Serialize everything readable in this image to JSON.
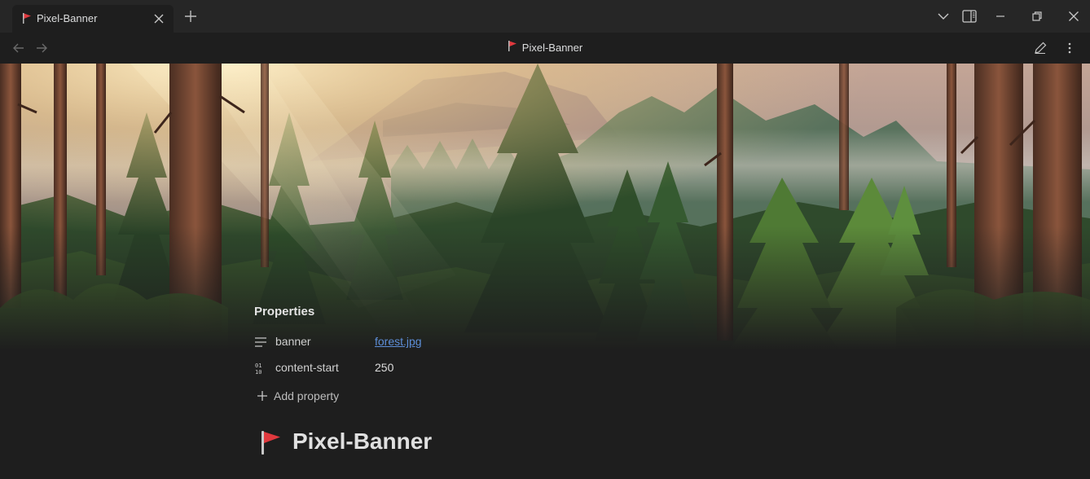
{
  "tabbar": {
    "active_tab": {
      "title": "Pixel-Banner",
      "icon": "flag-icon"
    },
    "new_tab_icon": "plus-icon",
    "controls": [
      "chevron-down-icon",
      "sidebar-toggle-icon",
      "minimize-icon",
      "restore-icon",
      "close-icon"
    ]
  },
  "navbar": {
    "title": "Pixel-Banner",
    "title_icon": "flag-icon",
    "back_icon": "arrow-left-icon",
    "forward_icon": "arrow-right-icon",
    "edit_icon": "pencil-icon",
    "more_icon": "more-vertical-icon"
  },
  "banner": {
    "image": "forest.jpg",
    "description_icon": "forest-banner-image"
  },
  "properties": {
    "heading": "Properties",
    "items": [
      {
        "key": "banner",
        "value": "forest.jpg",
        "icon": "text-lines-icon",
        "is_link": true
      },
      {
        "key": "content-start",
        "value": "250",
        "icon": "number-icon",
        "is_link": false
      }
    ],
    "add_label": "Add property"
  },
  "note": {
    "title": "Pixel-Banner",
    "title_emoji": "flag-icon"
  },
  "colors": {
    "background": "#1e1e1e",
    "tabbar": "#262626",
    "link": "#5d8ed8",
    "flag": "#e0393e"
  }
}
